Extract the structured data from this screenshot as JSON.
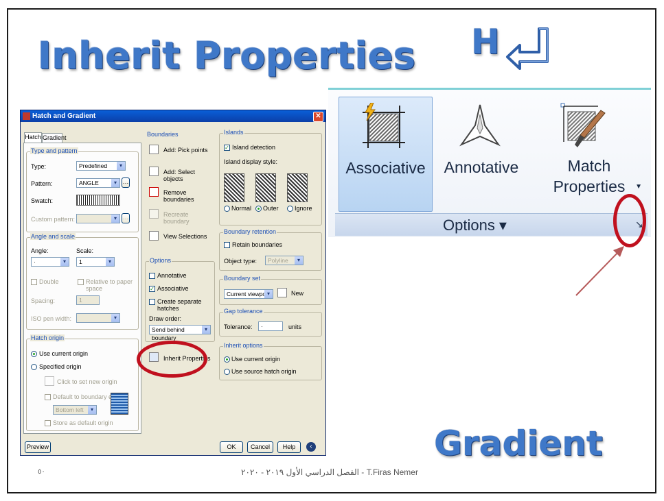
{
  "slide": {
    "title": "Inherit Properties",
    "shortcut_key": "H",
    "shortcut_icon": "enter-key-icon",
    "bottom_label": "Gradient",
    "footer_text": "الفصل الدراسي الأول ٢٠١٩ - ٢٠٢٠ - T.Firas Nemer",
    "page_number": "٥٠"
  },
  "ribbon": {
    "buttons": [
      {
        "label": "Associative",
        "icon": "associative-hatch-icon",
        "active": true
      },
      {
        "label": "Annotative",
        "icon": "annotative-scale-icon",
        "active": false
      },
      {
        "label_line1": "Match",
        "label_line2": "Properties",
        "icon": "match-properties-brush-icon",
        "has_dropdown": true
      }
    ],
    "panel_label": "Options ▾",
    "launcher_icon": "dialog-launcher-arrow-icon"
  },
  "dialog": {
    "title": "Hatch and Gradient",
    "tabs": [
      "Hatch",
      "Gradient"
    ],
    "type_pattern": {
      "group": "Type and pattern",
      "type_label": "Type:",
      "type_value": "Predefined",
      "pattern_label": "Pattern:",
      "pattern_value": "ANGLE",
      "swatch_label": "Swatch:",
      "custom_label": "Custom pattern:"
    },
    "angle_scale": {
      "group": "Angle and scale",
      "angle_label": "Angle:",
      "angle_value": "·",
      "scale_label": "Scale:",
      "scale_value": "1",
      "double_label": "Double",
      "relative_label": "Relative to paper space",
      "spacing_label": "Spacing:",
      "spacing_value": "1",
      "iso_label": "ISO pen width:"
    },
    "hatch_origin": {
      "group": "Hatch origin",
      "use_current": "Use current origin",
      "specified": "Specified origin",
      "click_set": "Click to set new origin",
      "default_extents": "Default to boundary extents",
      "position_value": "Bottom left",
      "store_default": "Store as default origin"
    },
    "boundaries": {
      "group": "Boundaries",
      "add_pick": "Add: Pick points",
      "add_select": "Add: Select objects",
      "remove": "Remove boundaries",
      "recreate": "Recreate boundary",
      "view": "View Selections"
    },
    "options": {
      "group": "Options",
      "annotative": "Annotative",
      "associative": "Associative",
      "separate": "Create separate hatches",
      "draw_order_label": "Draw order:",
      "draw_order_value": "Send behind boundary",
      "inherit": "Inherit Properties"
    },
    "islands": {
      "group": "Islands",
      "detection": "Island detection",
      "style_label": "Island display style:",
      "normal": "Normal",
      "outer": "Outer",
      "ignore": "Ignore"
    },
    "boundary_retention": {
      "group": "Boundary retention",
      "retain": "Retain boundaries",
      "object_type_label": "Object type:",
      "object_type_value": "Polyline"
    },
    "boundary_set": {
      "group": "Boundary set",
      "value": "Current viewport",
      "new_label": "New"
    },
    "gap_tolerance": {
      "group": "Gap tolerance",
      "label": "Tolerance:",
      "value": "·",
      "units": "units"
    },
    "inherit_options": {
      "group": "Inherit options",
      "use_current": "Use current origin",
      "use_source": "Use source hatch origin"
    },
    "buttons": {
      "preview": "Preview",
      "ok": "OK",
      "cancel": "Cancel",
      "help": "Help"
    }
  },
  "colors": {
    "title_blue": "#3f78c8",
    "highlight_red": "#c0101e",
    "ribbon_accent": "#7fd0d6",
    "arrow": "#b65a5a"
  }
}
